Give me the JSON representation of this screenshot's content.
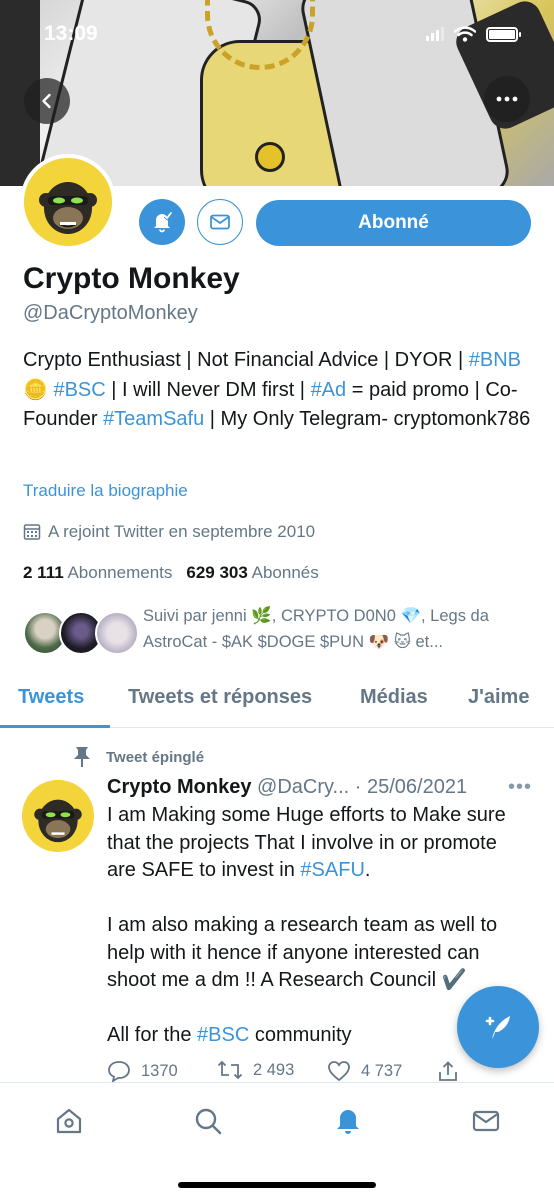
{
  "status_bar": {
    "time": "13:09"
  },
  "profile": {
    "display_name": "Crypto Monkey",
    "handle": "@DaCryptoMonkey",
    "follow_button_label": "Abonné",
    "bio": {
      "p1": "Crypto Enthusiast | Not Financial Advice | DYOR | ",
      "tag_bnb": "#BNB",
      "emoji_bnb": "🪙",
      "p2": " ",
      "tag_bsc": "#BSC",
      "p3": " | I will Never DM first | ",
      "tag_ad": "#Ad",
      "p4": " = paid promo | Co-Founder ",
      "tag_teamsafu": "#TeamSafu",
      "p5": " | My Only Telegram- cryptomonk786"
    },
    "translate_link": "Traduire la biographie",
    "joined": "A rejoint Twitter en septembre 2010",
    "following_count": "2 111",
    "following_label": "Abonnements",
    "followers_count": "629 303",
    "followers_label": "Abonnés",
    "followed_by": "Suivi par jenni 🌿, CRYPTO D0N0 💎, Legs da AstroCat - $AK $DOGE $PUN 🐶 🐱 et..."
  },
  "tabs": [
    {
      "label": "Tweets"
    },
    {
      "label": "Tweets et réponses"
    },
    {
      "label": "Médias"
    },
    {
      "label": "J'aime"
    }
  ],
  "pinned_tweet": {
    "pinned_label": "Tweet épinglé",
    "author_name": "Crypto Monkey",
    "author_handle": "@DaCry...",
    "separator": " · ",
    "date": "25/06/2021",
    "text_1": "I am Making some Huge efforts to Make sure that the projects That I involve in or promote are SAFE to invest in ",
    "tag_safu": "#SAFU",
    "text_2": ".\n\nI am also making a research team as well to help with it hence if anyone interested can shoot me a dm !! A Research Council ✔️\n\nAll for the ",
    "tag_bsc": "#BSC",
    "text_3": " community",
    "reply_count": "1370",
    "retweet_count": "2 493",
    "like_count": "4 737"
  },
  "colors": {
    "accent": "#3b94d9",
    "text": "#14171a",
    "secondary_text": "#657786",
    "avatar_bg": "#f3d43b"
  },
  "icons": {
    "status": [
      "signal-icon",
      "wifi-icon",
      "battery-icon"
    ],
    "header": [
      "back-arrow-icon",
      "more-icon"
    ],
    "profile_actions": [
      "bell-icon",
      "mail-icon"
    ],
    "meta": [
      "calendar-icon",
      "pin-icon"
    ],
    "tweet_actions": [
      "reply-icon",
      "retweet-icon",
      "like-icon",
      "share-icon"
    ],
    "fab": "compose-icon",
    "bottom_nav": [
      "home-icon",
      "search-icon",
      "notifications-icon",
      "messages-icon"
    ]
  }
}
